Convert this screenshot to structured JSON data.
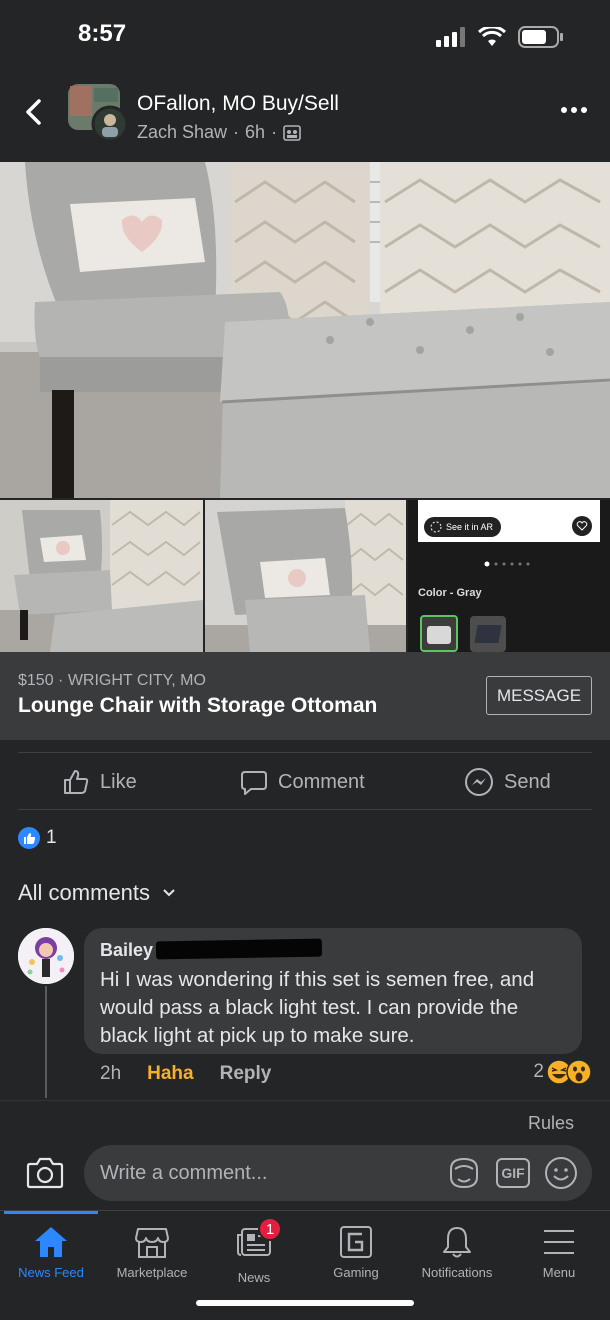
{
  "status_bar": {
    "time": "8:57"
  },
  "header": {
    "group_name": "OFallon, MO Buy/Sell",
    "author": "Zach Shaw",
    "time_ago": "6h"
  },
  "colors": {
    "accent": "#2d88ff",
    "background": "#242526",
    "surface": "#3a3b3c",
    "haha": "#f7b125",
    "badge": "#e41e3f"
  },
  "photo_panel": {
    "ar_label": "See it in AR",
    "color_label": "Color - Gray"
  },
  "listing": {
    "price_location": "$150 · WRIGHT CITY, MO",
    "title": "Lounge Chair with Storage Ottoman",
    "message_label": "MESSAGE"
  },
  "actions": {
    "like": "Like",
    "comment": "Comment",
    "send": "Send"
  },
  "reactions": {
    "count": "1"
  },
  "comments": {
    "header": "All comments",
    "items": [
      {
        "author": "Bailey",
        "text": "Hi I was wondering if this set is semen free, and would pass a black light test. I can provide the black light at pick up to make sure.",
        "time": "2h",
        "haha_label": "Haha",
        "reply_label": "Reply",
        "reaction_count": "2"
      }
    ]
  },
  "composer": {
    "rules": "Rules",
    "placeholder": "Write a comment...",
    "gif_label": "GIF"
  },
  "tabbar": {
    "items": [
      {
        "label": "News Feed",
        "icon": "home-icon",
        "active": true
      },
      {
        "label": "Marketplace",
        "icon": "marketplace-icon"
      },
      {
        "label": "News",
        "icon": "news-icon",
        "badge": "1"
      },
      {
        "label": "Gaming",
        "icon": "gaming-icon"
      },
      {
        "label": "Notifications",
        "icon": "bell-icon"
      },
      {
        "label": "Menu",
        "icon": "menu-icon"
      }
    ]
  }
}
